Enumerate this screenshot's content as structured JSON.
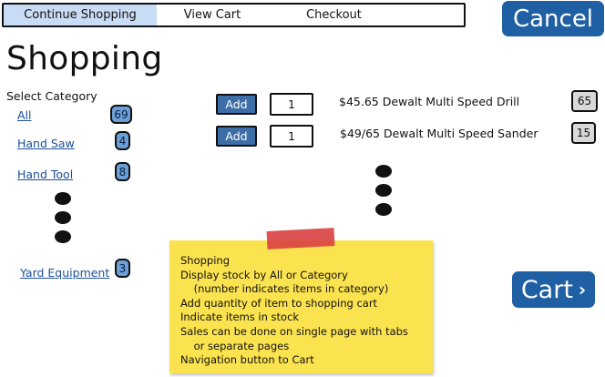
{
  "tabs": [
    {
      "label": "Continue Shopping",
      "active": true
    },
    {
      "label": "View Cart",
      "active": false
    },
    {
      "label": "Checkout",
      "active": false
    }
  ],
  "cancel_label": "Cancel",
  "cart_label": "Cart",
  "cart_icon": "chevron-right-icon",
  "page_title": "Shopping",
  "select_category_label": "Select Category",
  "categories": [
    {
      "label": "All",
      "count": "69"
    },
    {
      "label": "Hand Saw",
      "count": "4"
    },
    {
      "label": "Hand Tool",
      "count": "8"
    },
    {
      "label": "Yard Equipment",
      "count": "3"
    }
  ],
  "products": [
    {
      "add_label": "Add",
      "quantity": "1",
      "label": "$45.65 Dewalt Multi Speed Drill",
      "stock": "65"
    },
    {
      "add_label": "Add",
      "quantity": "1",
      "label": "$49/65 Dewalt Multi Speed Sander",
      "stock": "15"
    }
  ],
  "note_lines": [
    "Shopping",
    "Display stock by All or Category",
    "    (number indicates items in category)",
    "Add quantity of item to shopping cart",
    "Indicate items in stock",
    "Sales can be done on single page with tabs",
    "    or separate pages",
    "Navigation button to Cart"
  ],
  "colors": {
    "accent_blue": "#1f5fa3",
    "badge_blue": "#6b9fd6",
    "active_tab": "#c9dcf5",
    "sticky_note": "#fbe350",
    "tape_red": "#d94040"
  }
}
